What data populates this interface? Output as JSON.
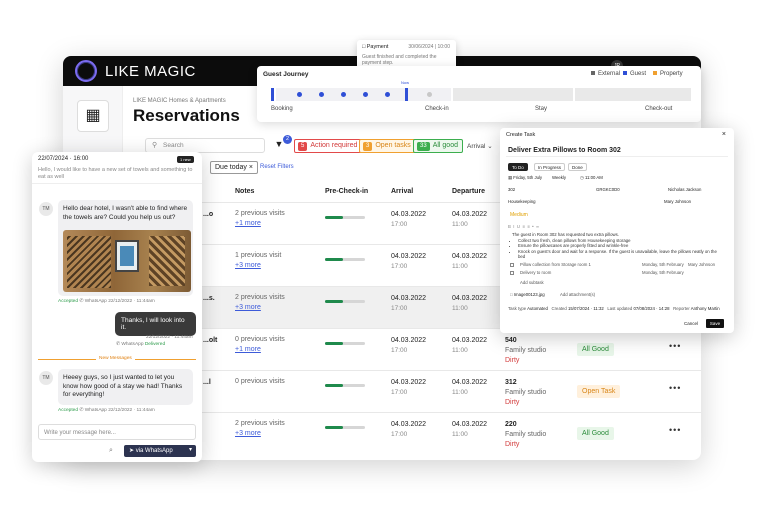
{
  "app": {
    "brand": "LIKE MAGIC",
    "breadcrumb": "LIKE MAGIC Homes & Apartments",
    "title": "Reservations",
    "avatar": "JR"
  },
  "toolbar": {
    "search_placeholder": "Search",
    "filter_badge": "2",
    "chips": [
      {
        "count": "5",
        "label": "Action required",
        "color": "#e24a4a"
      },
      {
        "count": "3",
        "label": "Open tasks",
        "color": "#f0a030"
      },
      {
        "count": "33",
        "label": "All good",
        "color": "#3cae4e"
      }
    ],
    "arrival_select": "Arrival",
    "due_today": "Due today",
    "reset": "Reset Filters"
  },
  "table": {
    "headers": [
      "Notes",
      "Pre-Check-in",
      "Arrival",
      "Departure"
    ],
    "rows": [
      {
        "name": "...o",
        "notes1": "2 previous visits",
        "notes2": "+1 more",
        "progress": 0.45,
        "arrival": "04.03.2022",
        "arr_time": "17:00",
        "departure": "04.03.2022",
        "dep_time": "11:00",
        "room": "",
        "type": "",
        "status": "",
        "badge": "",
        "highlight": false
      },
      {
        "name": "",
        "notes1": "1 previous visit",
        "notes2": "+3 more",
        "progress": 0.45,
        "arrival": "04.03.2022",
        "arr_time": "17:00",
        "departure": "04.03.2022",
        "dep_time": "11:00",
        "room": "",
        "type": "",
        "status": "",
        "badge": "",
        "highlight": false
      },
      {
        "name": "...s.",
        "notes1": "2 previous visits",
        "notes2": "+3 more",
        "progress": 0.45,
        "arrival": "04.03.2022",
        "arr_time": "17:00",
        "departure": "04.03.2022",
        "dep_time": "11:00",
        "room": "",
        "type": "",
        "status": "",
        "badge": "",
        "highlight": true
      },
      {
        "name": "...olt",
        "notes1": "0 previous visits",
        "notes2": "+1 more",
        "progress": 0.45,
        "arrival": "04.03.2022",
        "arr_time": "17:00",
        "departure": "04.03.2022",
        "dep_time": "11:00",
        "room": "540",
        "type": "Family studio",
        "status": "Dirty",
        "badge": "All Good",
        "highlight": false
      },
      {
        "name": "...l",
        "notes1": "0 previous visits",
        "notes2": "",
        "progress": 0.45,
        "arrival": "04.03.2022",
        "arr_time": "17:00",
        "departure": "04.03.2022",
        "dep_time": "11:00",
        "room": "312",
        "type": "Family studio",
        "status": "Dirty",
        "badge": "Open Task",
        "highlight": false
      },
      {
        "name": "",
        "notes1": "2 previous visits",
        "notes2": "+3 more",
        "progress": 0.45,
        "arrival": "04.03.2022",
        "arr_time": "17:00",
        "departure": "04.03.2022",
        "dep_time": "11:00",
        "room": "220",
        "type": "Family studio",
        "status": "Dirty",
        "badge": "All Good",
        "highlight": false
      }
    ]
  },
  "journey": {
    "title": "Guest Journey",
    "legend": [
      {
        "label": "External",
        "color": "#666666"
      },
      {
        "label": "Guest",
        "color": "#2f4fd6"
      },
      {
        "label": "Property",
        "color": "#f0a030"
      }
    ],
    "now_label": "Now",
    "phases": [
      "Booking",
      "Check-in",
      "Stay",
      "Check-out"
    ]
  },
  "payment": {
    "title": "Payment",
    "date": "30/06/2024 | 10:00",
    "message": "Guest finished and completed the payment step."
  },
  "chat": {
    "date": "22/07/2024 · 16:00",
    "new_badge": "1 new",
    "preview": "Hello, I would like to have a new set of towels and something to eat as well",
    "msg1": "Hello dear hotel, I wasn't able to find where the towels are? Could you help us out?",
    "msg1_meta": {
      "status": "Accepted",
      "channel": "WhatsApp",
      "time": "22/12/2022 · 11:44am"
    },
    "msg2": "Thanks, I will look into it.",
    "msg2_meta": {
      "time": "22/12/2022 · 11:44am",
      "channel": "WhatsApp",
      "status": "Delivered"
    },
    "new_messages": "New Messages",
    "msg3": "Heeey guys, so I just wanted to let you know how good of a stay we had! Thanks for everything!",
    "msg3_meta": {
      "status": "Accepted",
      "channel": "WhatsApp",
      "time": "22/12/2022 · 11:44am"
    },
    "avatar": "TM",
    "input_placeholder": "Write your message here...",
    "send": "via WhatsApp"
  },
  "task": {
    "header": "Create Task",
    "title": "Deliver Extra Pillows to Room 302",
    "statuses": [
      "To Do",
      "In Progress",
      "Done"
    ],
    "date": "Friday, 5th July",
    "repeat": "Weekly",
    "time": "11:00 AM",
    "linked_room": "302",
    "reservation": "GRGKC0D0",
    "guest": "Nicholas Jackson",
    "group": "Housekeeping",
    "assignee": "Mary Johnson",
    "highlight_label": "Medium",
    "body_intro": "The guest in Room 302 has requested two extra pillows.",
    "bullets": [
      "Collect two fresh, clean pillows from Housekeeping storage",
      "Ensure the pillowcases are properly fitted and wrinkle-free",
      "Knock on guest's door and wait for a response. If the guest is unavailable, leave the pillows neatly on the bed"
    ],
    "subtasks": [
      {
        "label": "Pillow collection from Storage room 1",
        "date": "Monday, 5th February",
        "who": "Mary Johnson"
      },
      {
        "label": "Delivery to room",
        "date": "Monday, 5th February",
        "who": ""
      }
    ],
    "add_subtask": "Add subtask",
    "attachment": "Image00123.jpg",
    "add_attachment": "Add attachment(s)",
    "footer": {
      "source_label": "Task type",
      "source": "Automated",
      "created_label": "Created",
      "created": "15/07/2024 · 11:32",
      "updated_label": "Last updated",
      "updated": "07/08/2024 · 14:28",
      "reporter_label": "Reporter",
      "reporter": "Anthony Martin"
    },
    "cancel": "Cancel",
    "save": "Save"
  }
}
